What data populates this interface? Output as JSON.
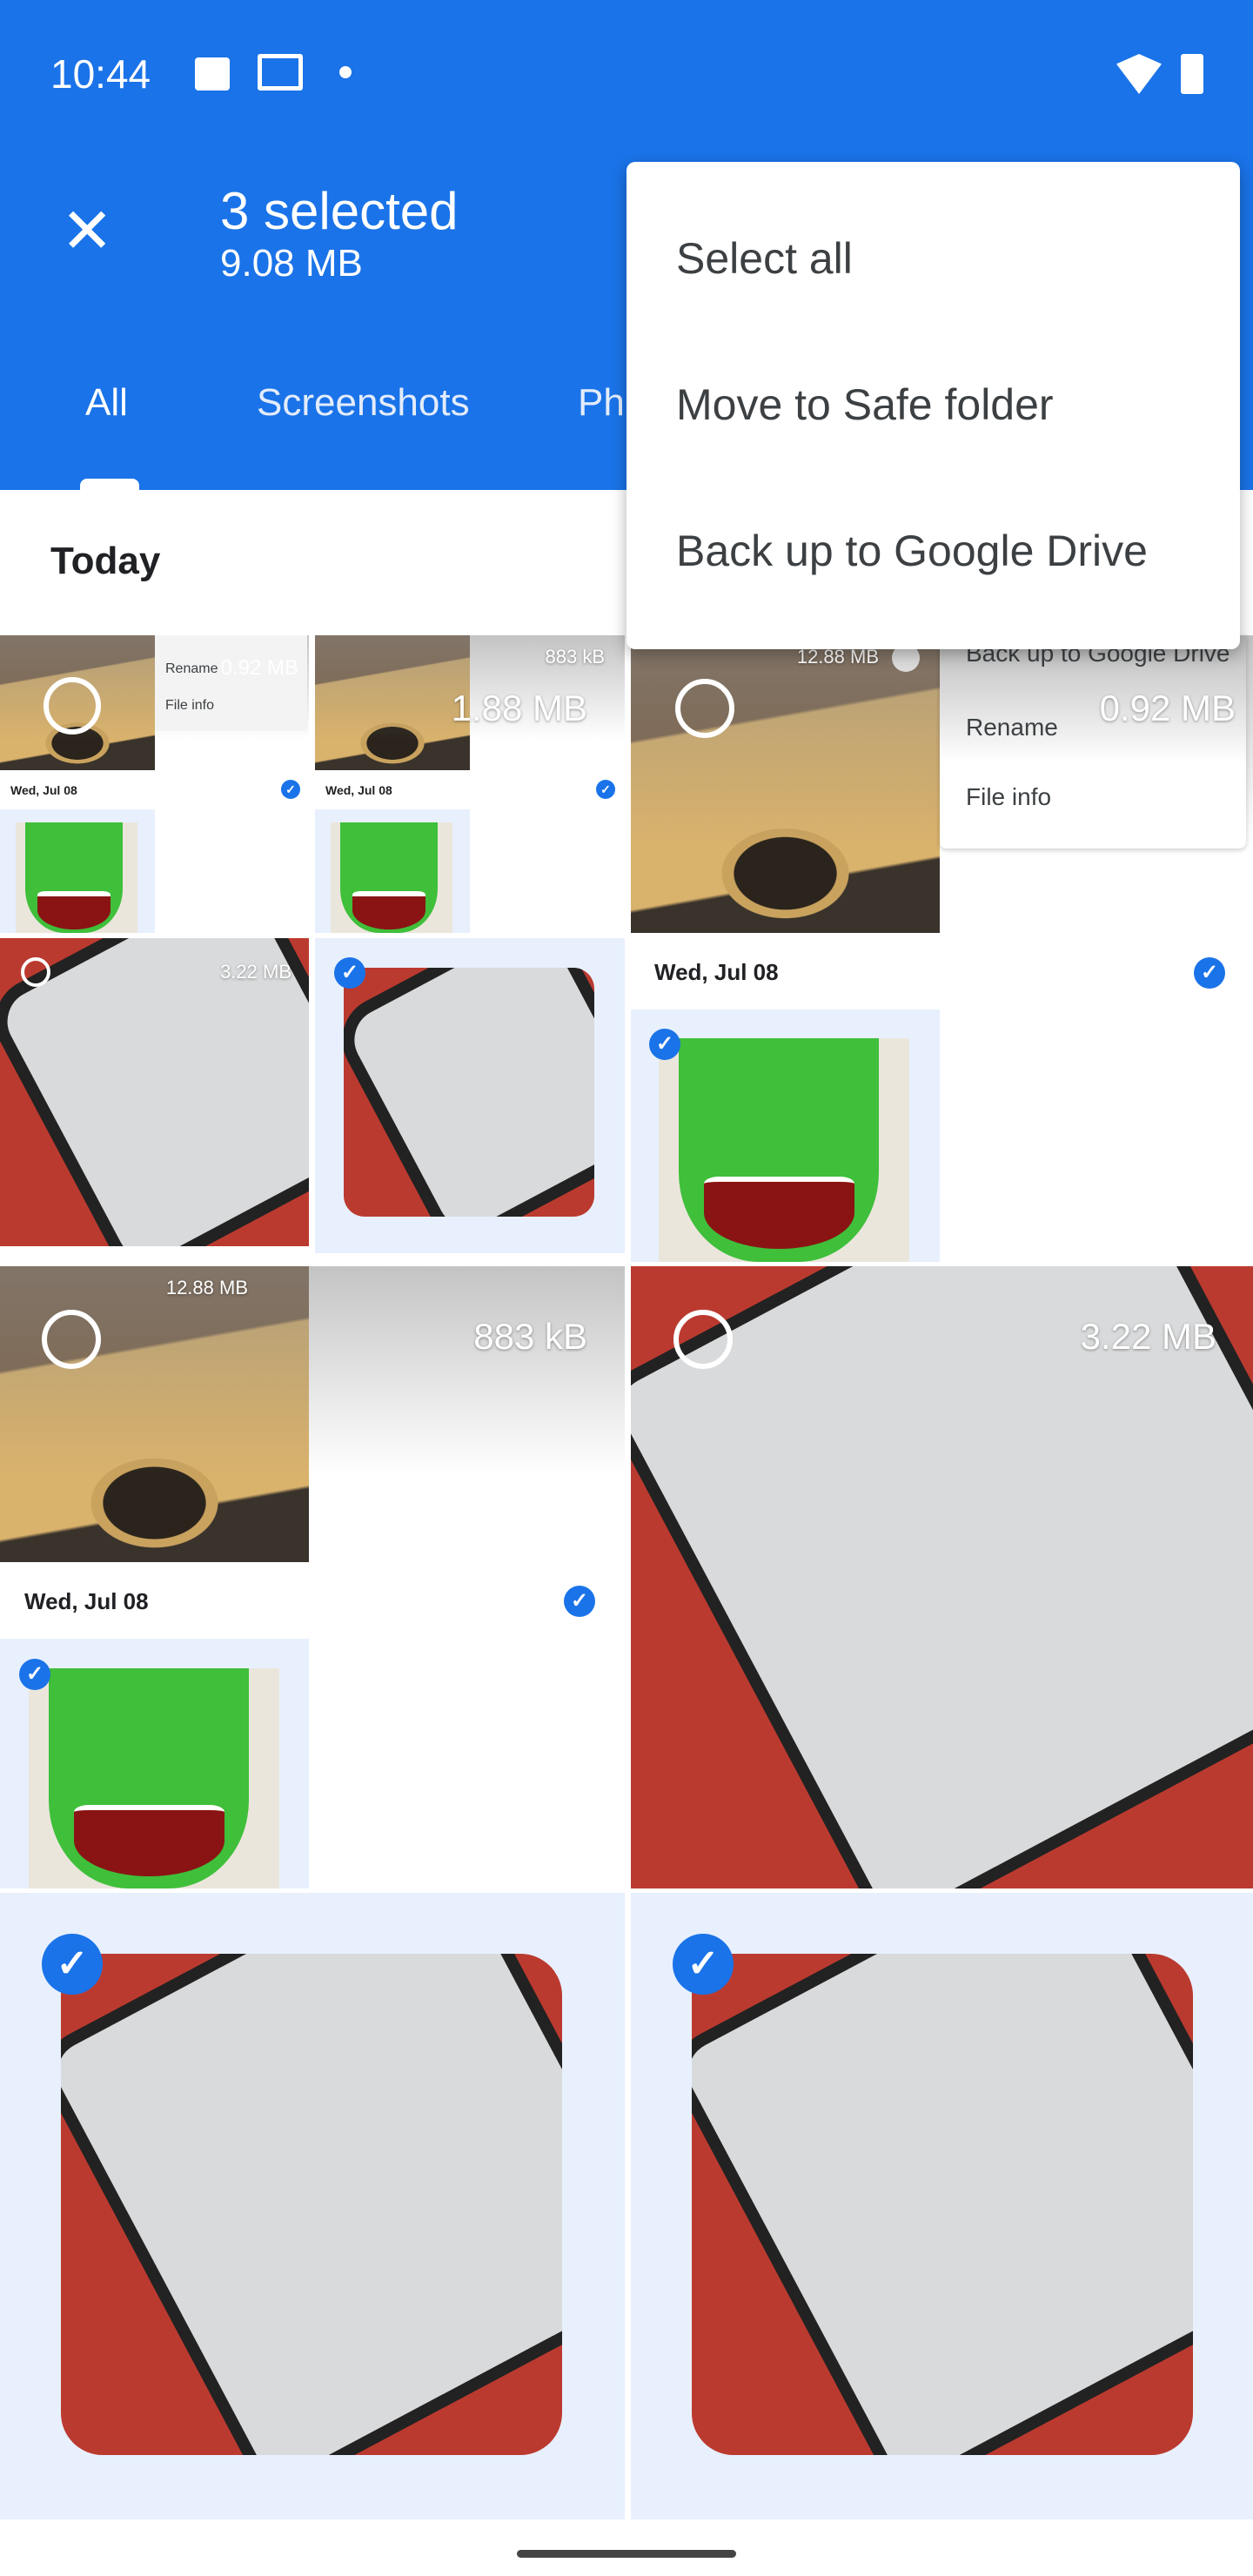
{
  "status": {
    "time": "10:44",
    "icons": [
      "image-icon",
      "gmail-icon",
      "dot-icon",
      "wifi-icon",
      "battery-icon"
    ]
  },
  "toolbar": {
    "title": "3 selected",
    "subtitle": "9.08 MB",
    "close_icon": "close-icon"
  },
  "tabs": [
    {
      "label": "All",
      "active": true
    },
    {
      "label": "Screenshots"
    },
    {
      "label": "Ph"
    }
  ],
  "section": {
    "title": "Today"
  },
  "menu": {
    "items": [
      "Select all",
      "Move to Safe folder",
      "Back up to Google Drive"
    ]
  },
  "grid": {
    "sizes": {
      "a": "0.92 MB",
      "b": "883 kB",
      "c": "1.88 MB",
      "d": "12.88 MB",
      "e": "3.22 MB"
    },
    "date": "Wed, Jul 08",
    "menu_fragment": [
      "Back up to Google Drive",
      "Rename",
      "File info"
    ]
  },
  "colors": {
    "accent": "#1a73e8",
    "selected_bg": "#e8f0fe"
  }
}
